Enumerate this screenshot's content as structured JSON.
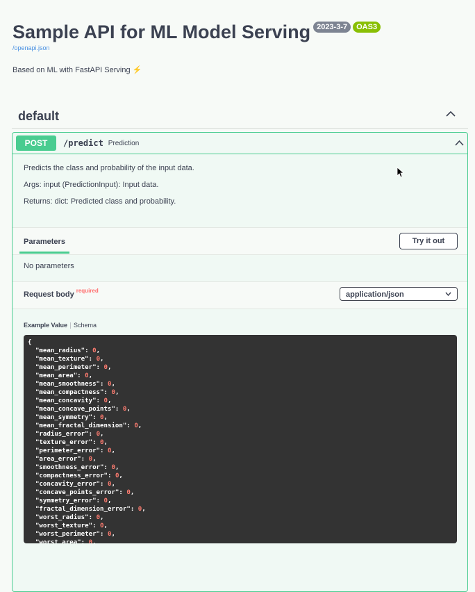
{
  "info": {
    "title": "Sample API for ML Model Serving",
    "version": "2023-3-7",
    "oas": "OAS3",
    "spec_url": "/openapi.json",
    "description": "Based on ML with FastAPI Serving",
    "description_icon": "⚡"
  },
  "tag": {
    "name": "default"
  },
  "operation": {
    "method": "POST",
    "path": "/predict",
    "summary": "Prediction",
    "description": [
      "Predicts the class and probability of the input data.",
      "Args: input (PredictionInput): Input data.",
      "Returns: dict: Predicted class and probability."
    ],
    "parameters_tab": "Parameters",
    "try_button": "Try it out",
    "no_params": "No parameters",
    "request_body": {
      "title": "Request body",
      "required": "required",
      "content_type": "application/json",
      "example_tab": "Example Value",
      "schema_tab": "Schema",
      "open_brace": "{",
      "fields": [
        "mean_radius",
        "mean_texture",
        "mean_perimeter",
        "mean_area",
        "mean_smoothness",
        "mean_compactness",
        "mean_concavity",
        "mean_concave_points",
        "mean_symmetry",
        "mean_fractal_dimension",
        "radius_error",
        "texture_error",
        "perimeter_error",
        "area_error",
        "smoothness_error",
        "compactness_error",
        "concavity_error",
        "concave_points_error",
        "symmetry_error",
        "fractal_dimension_error",
        "worst_radius",
        "worst_texture",
        "worst_perimeter",
        "worst_area"
      ],
      "field_value": "0"
    }
  },
  "colors": {
    "post_green": "#49cc90",
    "code_bg": "#333333",
    "number": "#fc7b6f",
    "required": "#ff6f6f"
  }
}
